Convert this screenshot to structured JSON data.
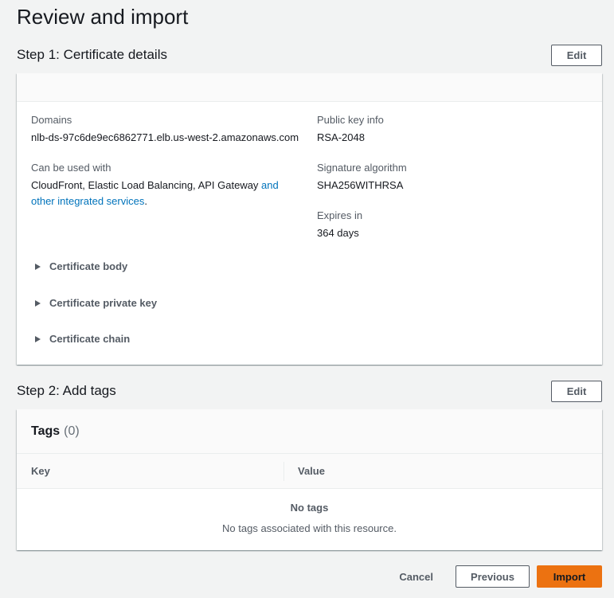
{
  "page": {
    "title": "Review and import"
  },
  "step1": {
    "title": "Step 1: Certificate details",
    "edit_label": "Edit",
    "domains_label": "Domains",
    "domains_value": "nlb-ds-97c6de9ec6862771.elb.us-west-2.amazonaws.com",
    "used_with_label": "Can be used with",
    "used_with_value": "CloudFront, Elastic Load Balancing, API Gateway ",
    "used_with_link_1": "and",
    "used_with_link_2": "other integrated services",
    "used_with_end": ".",
    "public_key_label": "Public key info",
    "public_key_value": "RSA-2048",
    "signature_label": "Signature algorithm",
    "signature_value": "SHA256WITHRSA",
    "expires_label": "Expires in",
    "expires_value": "364 days",
    "expanders": {
      "body": "Certificate body",
      "private_key": "Certificate private key",
      "chain": "Certificate chain"
    }
  },
  "step2": {
    "title": "Step 2: Add tags",
    "edit_label": "Edit",
    "tags_title": "Tags",
    "tags_count": "(0)",
    "columns": {
      "key": "Key",
      "value": "Value"
    },
    "empty_title": "No tags",
    "empty_desc": "No tags associated with this resource."
  },
  "footer": {
    "cancel_label": "Cancel",
    "previous_label": "Previous",
    "import_label": "Import"
  },
  "colors": {
    "primary": "#ec7211",
    "link": "#0073bb",
    "background": "#f2f3f3"
  }
}
